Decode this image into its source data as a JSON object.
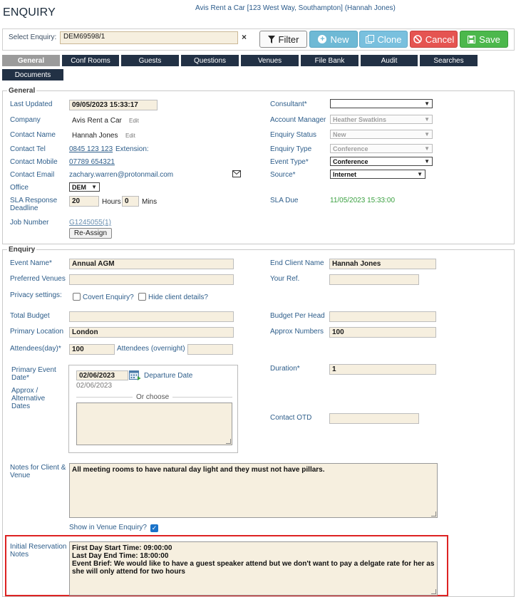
{
  "header": {
    "title": "ENQUIRY",
    "info": "Avis Rent a Car [123 West Way, Southampton] (Hannah Jones)"
  },
  "select_enquiry": {
    "label": "Select Enquiry:",
    "value": "DEM69598/1",
    "clear": "×"
  },
  "toolbar": {
    "filter": "Filter",
    "new": "New",
    "clone": "Clone",
    "cancel": "Cancel",
    "save": "Save"
  },
  "tabs": [
    "General",
    "Conf Rooms",
    "Guests",
    "Questions",
    "Venues",
    "File Bank",
    "Audit",
    "Searches",
    "Documents"
  ],
  "general": {
    "legend": "General",
    "last_updated": {
      "label": "Last Updated",
      "value": "09/05/2023 15:33:17"
    },
    "company": {
      "label": "Company",
      "value": "Avis Rent a Car",
      "edit": "Edit"
    },
    "contact_name": {
      "label": "Contact Name",
      "value": "Hannah Jones",
      "edit": "Edit"
    },
    "contact_tel": {
      "label": "Contact Tel",
      "value": "0845 123 123",
      "extension": "Extension:"
    },
    "contact_mobile": {
      "label": "Contact Mobile",
      "value": "07789 654321"
    },
    "contact_email": {
      "label": "Contact Email",
      "value": "zachary.warren@protonmail.com"
    },
    "office": {
      "label": "Office",
      "value": "DEM"
    },
    "sla_response": {
      "label": "SLA Response Deadline",
      "hours": "20",
      "hours_label": "Hours",
      "mins": "0",
      "mins_label": "Mins"
    },
    "job_number": {
      "label": "Job Number",
      "value": "G1245055(1)",
      "reassign": "Re-Assign"
    },
    "consultant": {
      "label": "Consultant*",
      "value": ""
    },
    "account_manager": {
      "label": "Account Manager",
      "value": "Heather Swatkins"
    },
    "enquiry_status": {
      "label": "Enquiry Status",
      "value": "New"
    },
    "enquiry_type": {
      "label": "Enquiry Type",
      "value": "Conference"
    },
    "event_type": {
      "label": "Event Type*",
      "value": "Conference"
    },
    "source": {
      "label": "Source*",
      "value": "Internet"
    },
    "sla_due": {
      "label": "SLA Due",
      "value": "11/05/2023 15:33:00"
    }
  },
  "enquiry": {
    "legend": "Enquiry",
    "event_name": {
      "label": "Event Name*",
      "value": "Annual AGM"
    },
    "preferred_venues": {
      "label": "Preferred Venues",
      "value": ""
    },
    "privacy": {
      "label": "Privacy settings:",
      "covert": "Covert Enquiry?",
      "hide": "Hide client details?"
    },
    "total_budget": {
      "label": "Total Budget",
      "value": ""
    },
    "primary_location": {
      "label": "Primary Location",
      "value": "London"
    },
    "attendees_day": {
      "label": "Attendees(day)*",
      "value": "100"
    },
    "attendees_overnight": {
      "label": "Attendees (overnight)",
      "value": ""
    },
    "primary_event_date": {
      "label": "Primary Event Date*",
      "value": "02/06/2023",
      "departure": "Departure Date",
      "sub": "02/06/2023"
    },
    "alt_dates": {
      "label": "Approx / Alternative Dates",
      "or_choose": "Or choose"
    },
    "end_client_name": {
      "label": "End Client Name",
      "value": "Hannah Jones"
    },
    "your_ref": {
      "label": "Your Ref.",
      "value": ""
    },
    "budget_per_head": {
      "label": "Budget Per Head",
      "value": ""
    },
    "approx_numbers": {
      "label": "Approx Numbers",
      "value": "100"
    },
    "duration": {
      "label": "Duration*",
      "value": "1"
    },
    "contact_otd": {
      "label": "Contact OTD",
      "value": ""
    },
    "notes": {
      "label": "Notes for Client & Venue",
      "value": "All meeting rooms to have natural day light and they must not have pillars."
    },
    "show_in_venue": {
      "label": "Show in Venue Enquiry?"
    },
    "initial_notes": {
      "label": "Initial Reservation Notes",
      "line1": "First Day Start Time: 09:00:00",
      "line2": "Last Day End Time: 18:00:00",
      "line3": "Event Brief: We would like to have a guest speaker attend but we don't want to pay a delgate rate for her as she will only attend for two hours"
    }
  },
  "colors": {
    "tab_bg": "#223145",
    "tab_active": "#9b9b9b",
    "input_bg": "#f6efdf",
    "label": "#2d5d8a",
    "highlight": "#dd2222"
  }
}
